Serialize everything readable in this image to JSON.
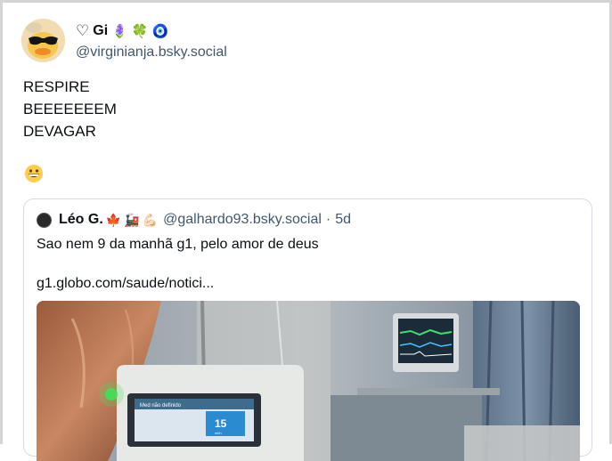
{
  "post": {
    "author": {
      "display_name": "Gi",
      "emojis": [
        "🪻",
        "🍀",
        "🧿"
      ],
      "handle": "@virginianja.bsky.social"
    },
    "text": "RESPIRE\nBEEEEEEEM\nDEVAGAR",
    "reaction_emoji": "😁"
  },
  "quote": {
    "author": {
      "display_name": "Léo G.",
      "emojis": [
        "🍁",
        "🚂",
        "💪🏻"
      ],
      "handle": "@galhardo93.bsky.social",
      "separator": "·",
      "time": "5d"
    },
    "text": "Sao nem 9 da manhã g1, pelo amor de deus",
    "link": "g1.globo.com/saude/notici...",
    "image": {
      "monitor_label": "Med não definido",
      "monitor_value": "15",
      "monitor_unit": "ml/h"
    }
  },
  "colors": {
    "text": "#0b0f14",
    "secondary_text": "#42576c",
    "card_border": "#d4dbe2"
  }
}
